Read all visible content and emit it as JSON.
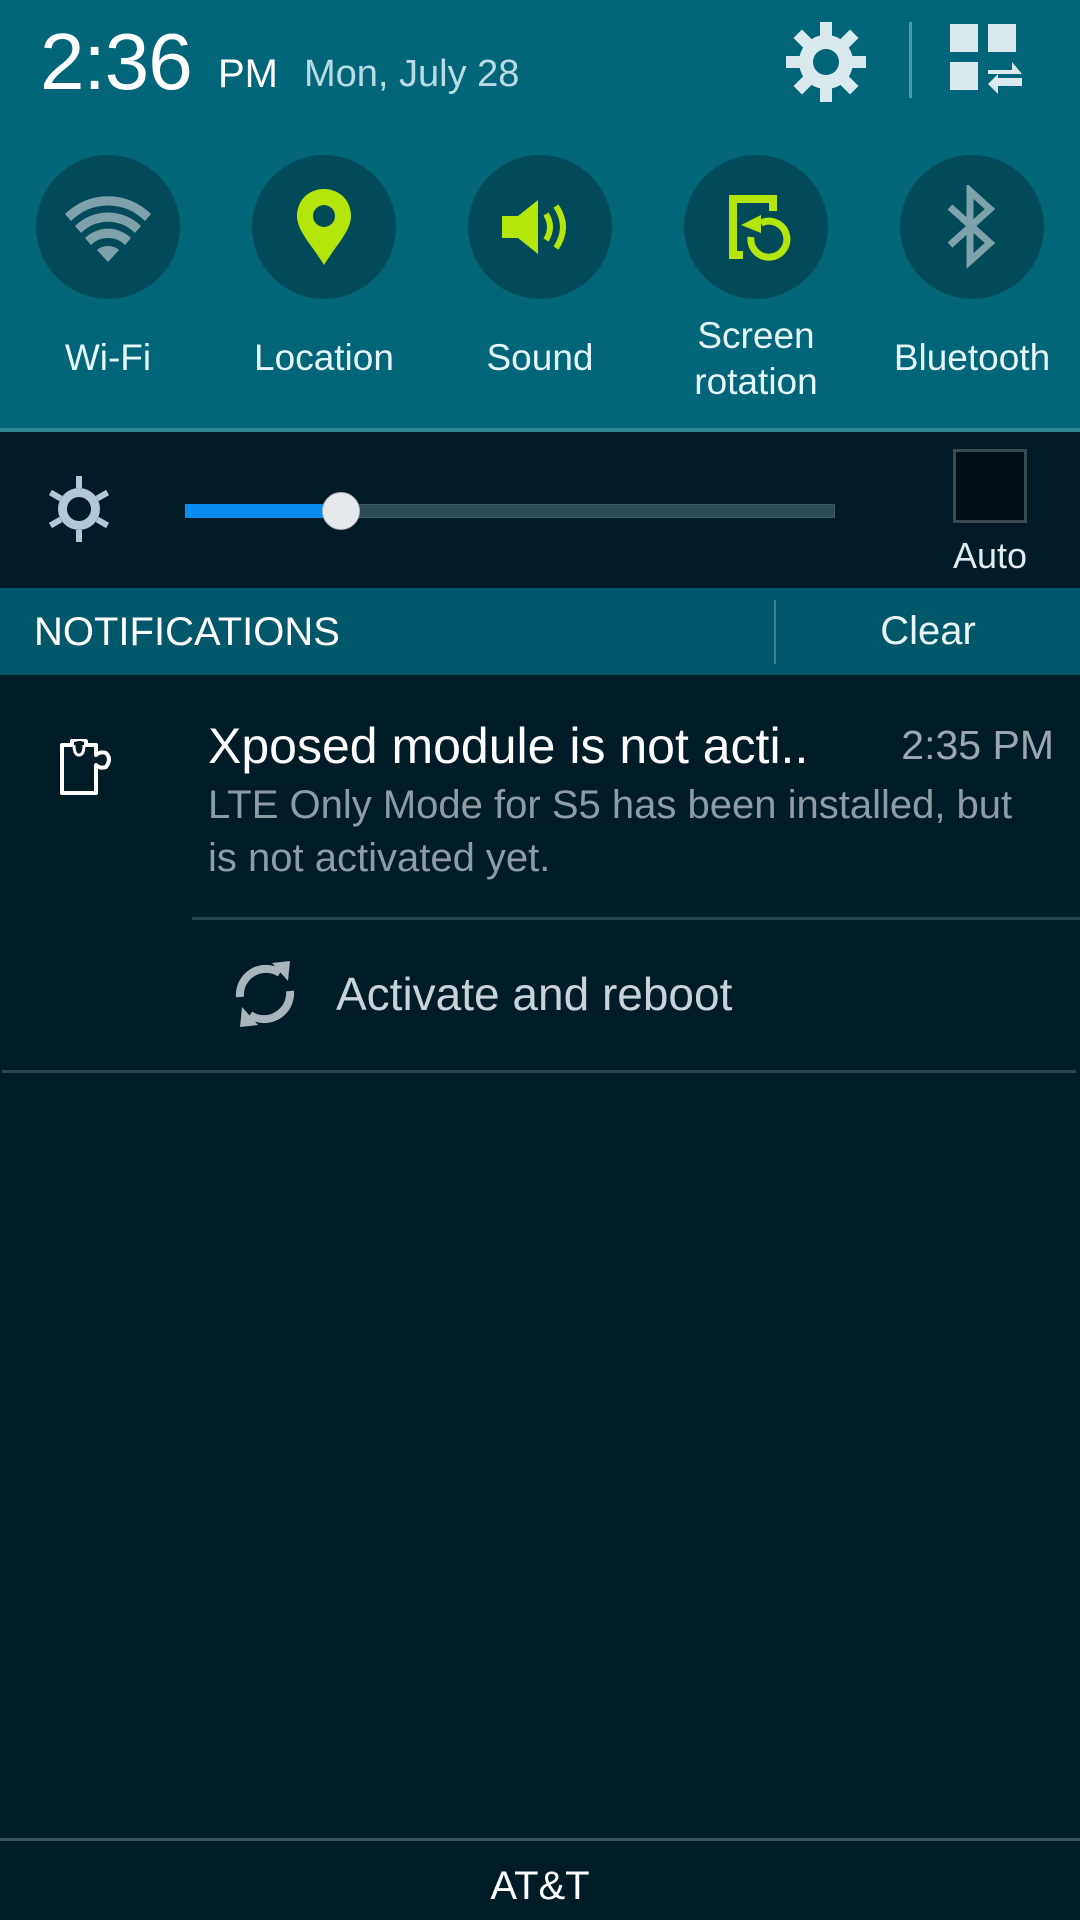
{
  "status": {
    "time": "2:36",
    "ampm": "PM",
    "date": "Mon, July 28"
  },
  "header_actions": {
    "settings_icon": "gear-icon",
    "edit_icon": "grid-swap-icon"
  },
  "quick_toggles": [
    {
      "label": "Wi-Fi",
      "icon": "wifi-icon",
      "active": false
    },
    {
      "label": "Location",
      "icon": "location-pin-icon",
      "active": true
    },
    {
      "label": "Sound",
      "icon": "speaker-icon",
      "active": true
    },
    {
      "label": "Screen rotation",
      "label_line1": "Screen",
      "label_line2": "rotation",
      "icon": "screen-rotation-icon",
      "active": true
    },
    {
      "label": "Bluetooth",
      "icon": "bluetooth-icon",
      "active": false
    }
  ],
  "brightness": {
    "level_percent": 24,
    "auto_label": "Auto",
    "auto_checked": false
  },
  "notifications": {
    "header": "NOTIFICATIONS",
    "clear_label": "Clear",
    "items": [
      {
        "icon": "puzzle-piece-icon",
        "title": "Xposed module is not acti..",
        "time": "2:35 PM",
        "body": "LTE Only Mode for S5 has been installed, but is not activated yet.",
        "action": {
          "icon": "refresh-icon",
          "label": "Activate and reboot"
        }
      }
    ]
  },
  "footer": {
    "carrier": "AT&T"
  },
  "colors": {
    "header_bg": "#02657a",
    "toggle_circle": "#024a5a",
    "active_accent": "#b4e60c",
    "inactive_icon": "#7fa2aa",
    "slider_fill": "#0a8ff0",
    "panel_bg": "#001c27",
    "notif_header_bg": "#03576a"
  }
}
